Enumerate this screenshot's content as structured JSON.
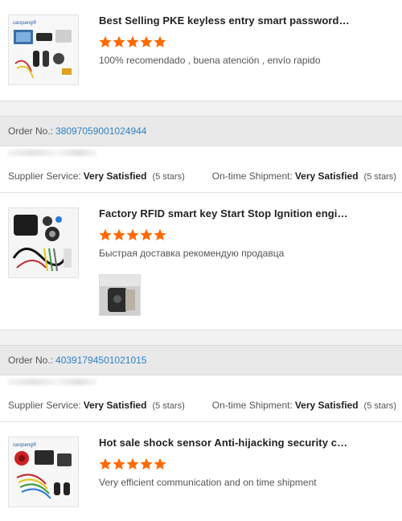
{
  "colors": {
    "accent_link": "#2f80c9",
    "star": "#ff6a00",
    "separator_bg": "#f2f2f2",
    "header_bg": "#e9e9e9"
  },
  "products": [
    {
      "title": "Best Selling PKE keyless entry smart password…",
      "review": "100% recomendado , buena atención , envío rapido",
      "thumb_brand": "carqseng®",
      "stars": 5
    },
    {
      "title": "Factory RFID smart key Start Stop Ignition engi…",
      "review": "Быстрая доставка рекомендую продавца",
      "stars": 5,
      "has_photo": true
    },
    {
      "title": "Hot sale shock sensor Anti-hijacking security c…",
      "review": "Very efficient communication and on time shipment",
      "thumb_brand": "carqseng®",
      "stars": 5
    }
  ],
  "orders": [
    {
      "order_label": "Order No.:",
      "order_number": "38097059001024944",
      "supplier_label": "Supplier Service:",
      "supplier_value": "Very Satisfied",
      "supplier_stars": "(5 stars)",
      "shipment_label": "On-time Shipment:",
      "shipment_value": "Very Satisfied",
      "shipment_stars": "(5 stars)"
    },
    {
      "order_label": "Order No.:",
      "order_number": "40391794501021015",
      "supplier_label": "Supplier Service:",
      "supplier_value": "Very Satisfied",
      "supplier_stars": "(5 stars)",
      "shipment_label": "On-time Shipment:",
      "shipment_value": "Very Satisfied",
      "shipment_stars": "(5 stars)"
    }
  ]
}
